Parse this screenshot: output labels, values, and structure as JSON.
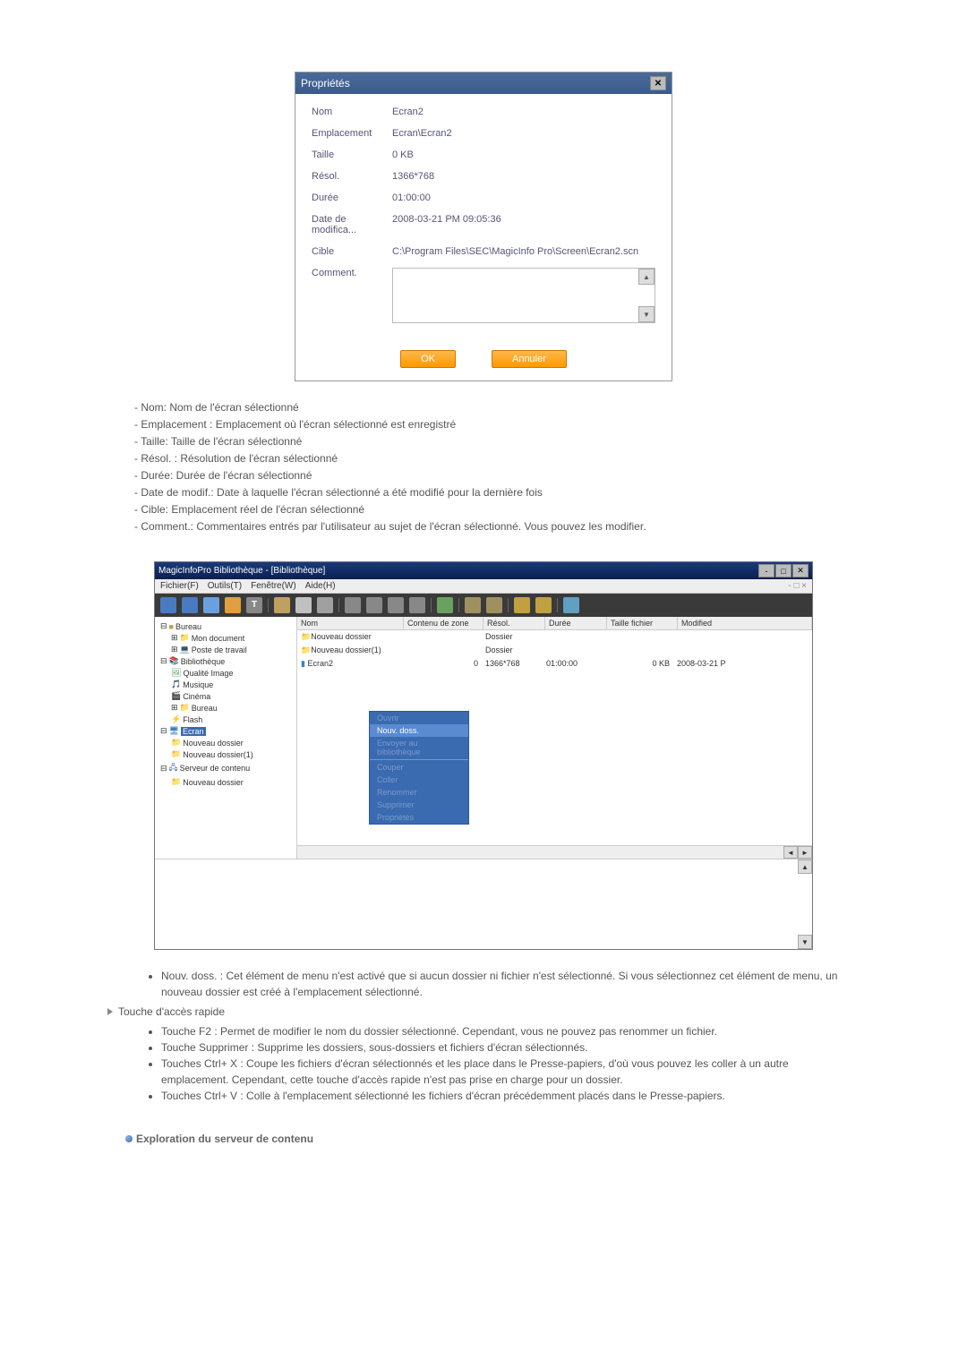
{
  "dialog": {
    "title": "Propriétés",
    "rows": {
      "name_label": "Nom",
      "name_val": "Ecran2",
      "loc_label": "Emplacement",
      "loc_val": "Ecran\\Ecran2",
      "size_label": "Taille",
      "size_val": "0 KB",
      "resol_label": "Résol.",
      "resol_val": "1366*768",
      "dur_label": "Durée",
      "dur_val": "01:00:00",
      "mod_label": "Date de modifica...",
      "mod_val": "2008-03-21 PM 09:05:36",
      "target_label": "Cible",
      "target_val": "C:\\Program Files\\SEC\\MagicInfo Pro\\Screen\\Ecran2.scn",
      "comment_label": "Comment."
    },
    "buttons": {
      "ok": "OK",
      "cancel": "Annuler"
    }
  },
  "descriptions": {
    "d1": "- Nom: Nom de l'écran sélectionné",
    "d2": "- Emplacement : Emplacement où l'écran sélectionné est enregistré",
    "d3": "- Taille: Taille de l'écran sélectionné",
    "d4": "- Résol. : Résolution de l'écran sélectionné",
    "d5": "- Durée: Durée de l'écran sélectionné",
    "d6": "- Date de modif.: Date à laquelle l'écran sélectionné a été modifié pour la dernière fois",
    "d7": "- Cible: Emplacement réel de l'écran sélectionné",
    "d8": "- Comment.: Commentaires entrés par l'utilisateur au sujet de l'écran sélectionné. Vous pouvez les modifier."
  },
  "window": {
    "title": "MagicInfoPro Bibliothèque - [Bibliothèque]",
    "menu": {
      "file": "Fichier(F)",
      "tools": "Outils(T)",
      "window": "Fenêtre(W)",
      "help": "Aide(H)"
    },
    "tree": {
      "bureau": "Bureau",
      "mondoc": "Mon document",
      "poste": "Poste de travail",
      "biblio": "Bibliothèque",
      "qimage": "Qualité Image",
      "musique": "Musique",
      "cinema": "Cinéma",
      "bureau2": "Bureau",
      "flash": "Flash",
      "ecran": "Ecran",
      "nd": "Nouveau dossier",
      "nd1": "Nouveau dossier(1)",
      "serveur": "Serveur de contenu",
      "nd2": "Nouveau dossier"
    },
    "headers": {
      "nom": "Nom",
      "zone": "Contenu de zone",
      "resol": "Résol.",
      "duree": "Durée",
      "taille": "Taille fichier",
      "modified": "Modified"
    },
    "rows": {
      "r1": {
        "nom": "Nouveau dossier",
        "resol": "Dossier"
      },
      "r2": {
        "nom": "Nouveau dossier(1)",
        "resol": "Dossier"
      },
      "r3": {
        "nom": "Ecran2",
        "zone": "0",
        "resol": "1366*768",
        "duree": "01:00:00",
        "taille": "0 KB",
        "modified": "2008-03-21 P"
      }
    },
    "context": {
      "ouvrir": "Ouvrir",
      "nouv": "Nouv. doss.",
      "env": "Envoyer au bibliothèque",
      "couper": "Couper",
      "coller": "Coller",
      "renommer": "Renommer",
      "supprimer": "Supprimer",
      "propriete": "Propriétés"
    }
  },
  "notes": {
    "nouv": "Nouv. doss. : Cet élément de menu n'est activé que si aucun dossier ni fichier n'est sélectionné. Si vous sélectionnez cet élément de menu, un nouveau dossier est créé à l'emplacement sélectionné.",
    "touche_head": "Touche d'accès rapide",
    "f2": "Touche F2 : Permet de modifier le nom du dossier sélectionné. Cependant, vous ne pouvez pas renommer un fichier.",
    "suppr": "Touche Supprimer : Supprime les dossiers, sous-dossiers et fichiers d'écran sélectionnés.",
    "cx": "Touches Ctrl+ X : Coupe les fichiers d'écran sélectionnés et les place dans le Presse-papiers, d'où vous pouvez les coller à un autre emplacement. Cependant, cette touche d'accès rapide n'est pas prise en charge pour un dossier.",
    "cv": "Touches Ctrl+ V : Colle à l'emplacement sélectionné les fichiers d'écran précédemment placés dans le Presse-papiers."
  },
  "section": {
    "title": "Exploration du serveur de contenu"
  }
}
